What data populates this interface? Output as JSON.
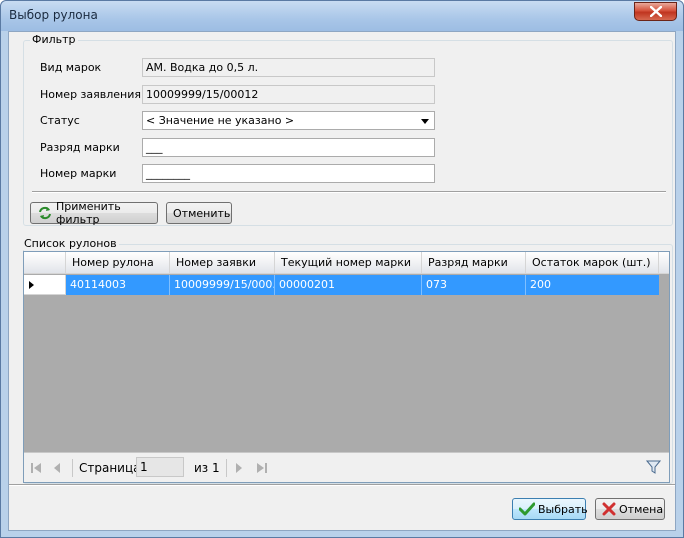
{
  "window": {
    "title": "Выбор рулона"
  },
  "filter": {
    "group_title": "Фильтр",
    "stamp_type_label": "Вид марок",
    "stamp_type_value": "АМ. Водка до 0,5 л.",
    "application_number_label": "Номер заявления",
    "application_number_value": "10009999/15/00012",
    "status_label": "Статус",
    "status_value": "< Значение не указано >",
    "stamp_range_label": "Разряд марки",
    "stamp_range_value": "___",
    "stamp_number_label": "Номер марки",
    "stamp_number_value": "________",
    "apply_button": "Применить фильтр",
    "cancel_button": "Отменить"
  },
  "rolls": {
    "group_title": "Список рулонов",
    "columns": [
      "Номер рулона",
      "Номер заявки",
      "Текущий номер марки",
      "Разряд марки",
      "Остаток марок (шт.)"
    ],
    "rows": [
      [
        "40114003",
        "10009999/15/000...",
        "00000201",
        "073",
        "200"
      ]
    ]
  },
  "pager": {
    "page_label": "Страница",
    "page_value": "1",
    "of_label": "из",
    "total_pages": "1"
  },
  "footer": {
    "select_button": "Выбрать",
    "cancel_button": "Отмена"
  },
  "colors": {
    "selection": "#3399ff",
    "grid_background": "#ababab"
  }
}
